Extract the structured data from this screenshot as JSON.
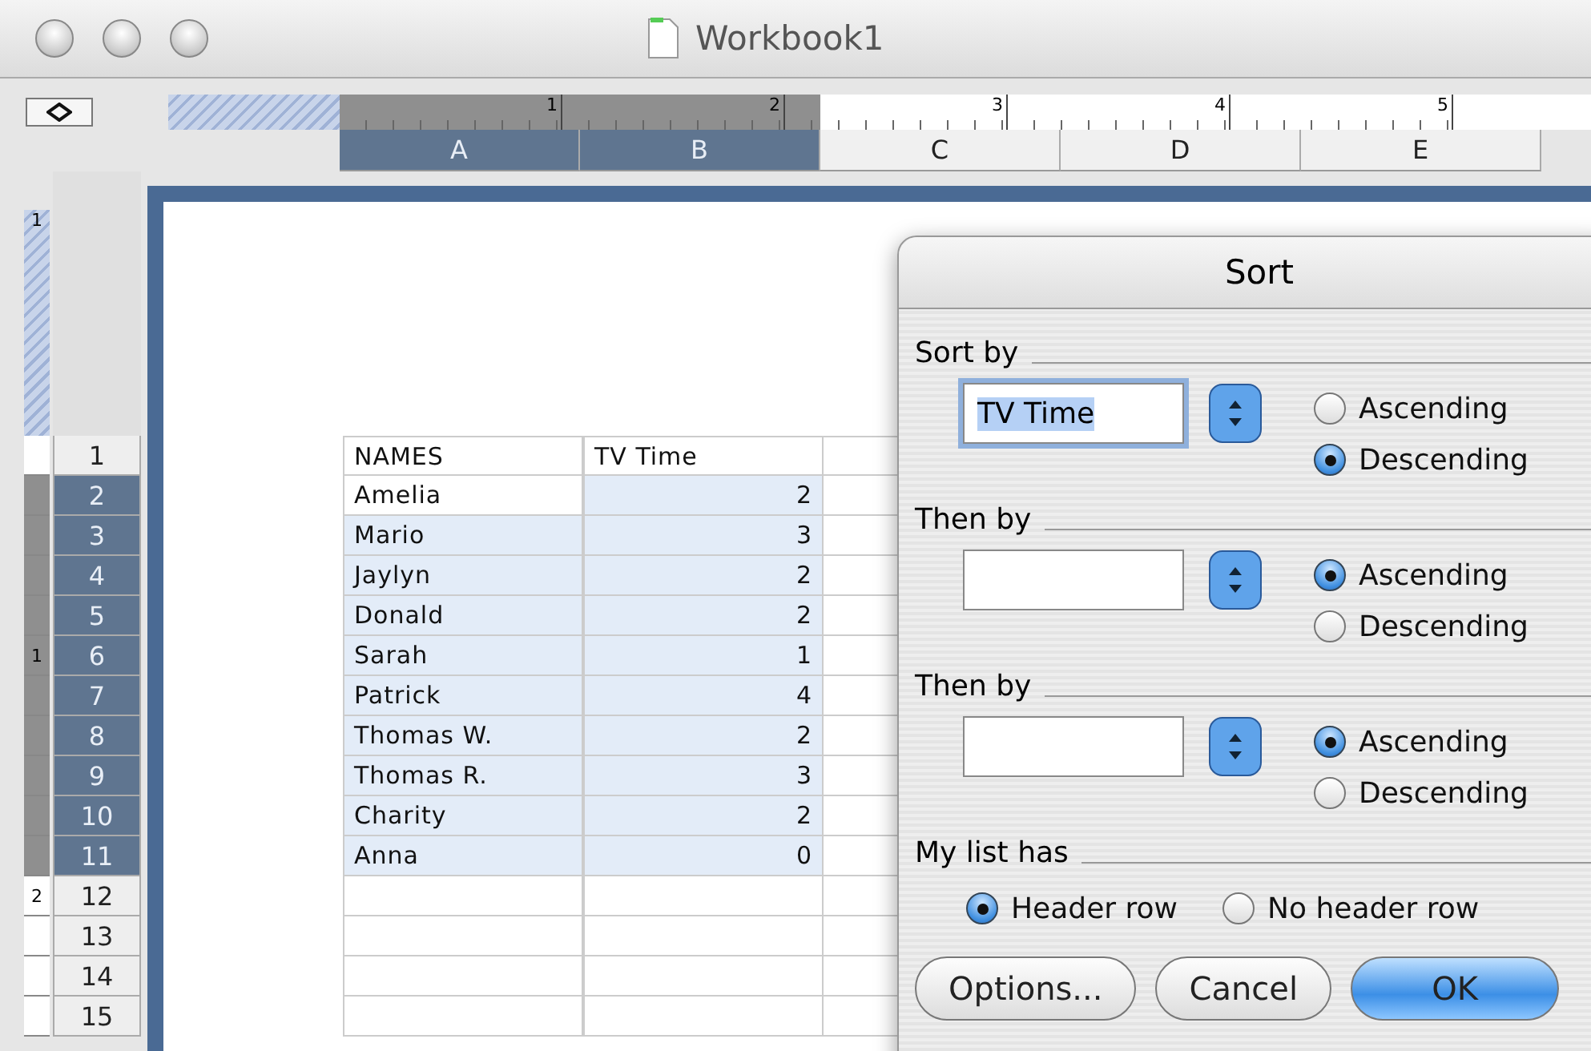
{
  "window": {
    "title": "Workbook1"
  },
  "ruler": {
    "top_labels": [
      "1",
      "2",
      "3",
      "4",
      "5"
    ],
    "side_top_label": "1"
  },
  "columns": [
    {
      "label": "A",
      "selected": true
    },
    {
      "label": "B",
      "selected": true
    },
    {
      "label": "C",
      "selected": false
    },
    {
      "label": "D",
      "selected": false
    },
    {
      "label": "E",
      "selected": false
    }
  ],
  "rows": [
    {
      "label": "1",
      "selected": false,
      "cells": [
        "NAMES",
        "TV Time"
      ]
    },
    {
      "label": "2",
      "selected": true,
      "active": true,
      "cells": [
        "Amelia",
        "2"
      ]
    },
    {
      "label": "3",
      "selected": true,
      "cells": [
        "Mario",
        "3"
      ]
    },
    {
      "label": "4",
      "selected": true,
      "cells": [
        "Jaylyn",
        "2"
      ]
    },
    {
      "label": "5",
      "selected": true,
      "cells": [
        "Donald",
        "2"
      ]
    },
    {
      "label": "6",
      "selected": true,
      "ruler_mark": "1",
      "cells": [
        "Sarah",
        "1"
      ]
    },
    {
      "label": "7",
      "selected": true,
      "cells": [
        "Patrick",
        "4"
      ]
    },
    {
      "label": "8",
      "selected": true,
      "cells": [
        "Thomas W.",
        "2"
      ]
    },
    {
      "label": "9",
      "selected": true,
      "cells": [
        "Thomas R.",
        "3"
      ]
    },
    {
      "label": "10",
      "selected": true,
      "cells": [
        "Charity",
        "2"
      ]
    },
    {
      "label": "11",
      "selected": true,
      "cells": [
        "Anna",
        "0"
      ]
    },
    {
      "label": "12",
      "selected": false,
      "ruler_mark": "2"
    },
    {
      "label": "13",
      "selected": false
    },
    {
      "label": "14",
      "selected": false
    },
    {
      "label": "15",
      "selected": false
    }
  ],
  "dialog": {
    "title": "Sort",
    "groups": [
      {
        "label": "Sort by",
        "field": "TV Time",
        "field_selected": true,
        "options": [
          {
            "label": "Ascending",
            "selected": false
          },
          {
            "label": "Descending",
            "selected": true
          }
        ]
      },
      {
        "label": "Then by",
        "options": [
          {
            "label": "Ascending",
            "selected": true
          },
          {
            "label": "Descending",
            "selected": false
          }
        ]
      },
      {
        "label": "Then by",
        "options": [
          {
            "label": "Ascending",
            "selected": true
          },
          {
            "label": "Descending",
            "selected": false
          }
        ]
      }
    ],
    "header": {
      "label": "My list has",
      "options": [
        {
          "label": "Header row",
          "selected": true
        },
        {
          "label": "No header row",
          "selected": false
        }
      ]
    },
    "buttons": [
      {
        "label": "Options...",
        "default": false
      },
      {
        "label": "Cancel",
        "default": false
      },
      {
        "label": "OK",
        "default": true
      }
    ]
  }
}
